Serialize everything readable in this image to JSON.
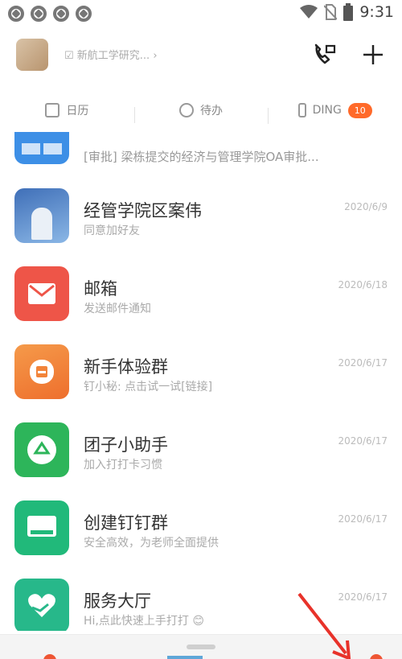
{
  "status_bar": {
    "time": "9:31",
    "icons": [
      "settings-icon",
      "settings-icon",
      "settings-icon",
      "settings-icon",
      "wifi-icon",
      "no-sim-icon",
      "battery-icon"
    ]
  },
  "header": {
    "org_name": "☑ 新航工学研究...  ›",
    "icons": [
      "call-icon",
      "plus-icon"
    ]
  },
  "tabs": [
    {
      "label": "日历",
      "icon": "calendar-icon"
    },
    {
      "label": "待办",
      "icon": "todo-icon"
    },
    {
      "label": "DING",
      "icon": "ding-icon",
      "badge": "10"
    }
  ],
  "list": [
    {
      "title": "",
      "subtitle": "[审批] 梁栋提交的经济与管理学院OA审批...",
      "date": "",
      "icon": "approval-icon",
      "color": "#3d8fe6"
    },
    {
      "title": "经管学院区案伟",
      "subtitle": "同意加好友",
      "date": "2020/6/9",
      "icon": "person-photo",
      "color": "#5a8ed6"
    },
    {
      "title": "邮箱",
      "subtitle": "发送邮件通知",
      "date": "2020/6/18",
      "icon": "mail-icon",
      "color": "#ee5548"
    },
    {
      "title": "新手体验群",
      "subtitle": "钉小秘: 点击试一试[链接]",
      "date": "2020/6/17",
      "icon": "chat-icon",
      "color": "#f2843a"
    },
    {
      "title": "团子小助手",
      "subtitle": "加入打打卡习惯",
      "date": "2020/6/17",
      "icon": "recycle-icon",
      "color": "#2db55a"
    },
    {
      "title": "创建钉钉群",
      "subtitle": "安全高效，为老师全面提供",
      "date": "2020/6/17",
      "icon": "group-icon",
      "color": "#21b97a"
    },
    {
      "title": "服务大厅",
      "subtitle": "Hi,点此快速上手打打 😊",
      "date": "2020/6/17",
      "icon": "heart-hand-icon",
      "color": "#27b88a"
    }
  ]
}
